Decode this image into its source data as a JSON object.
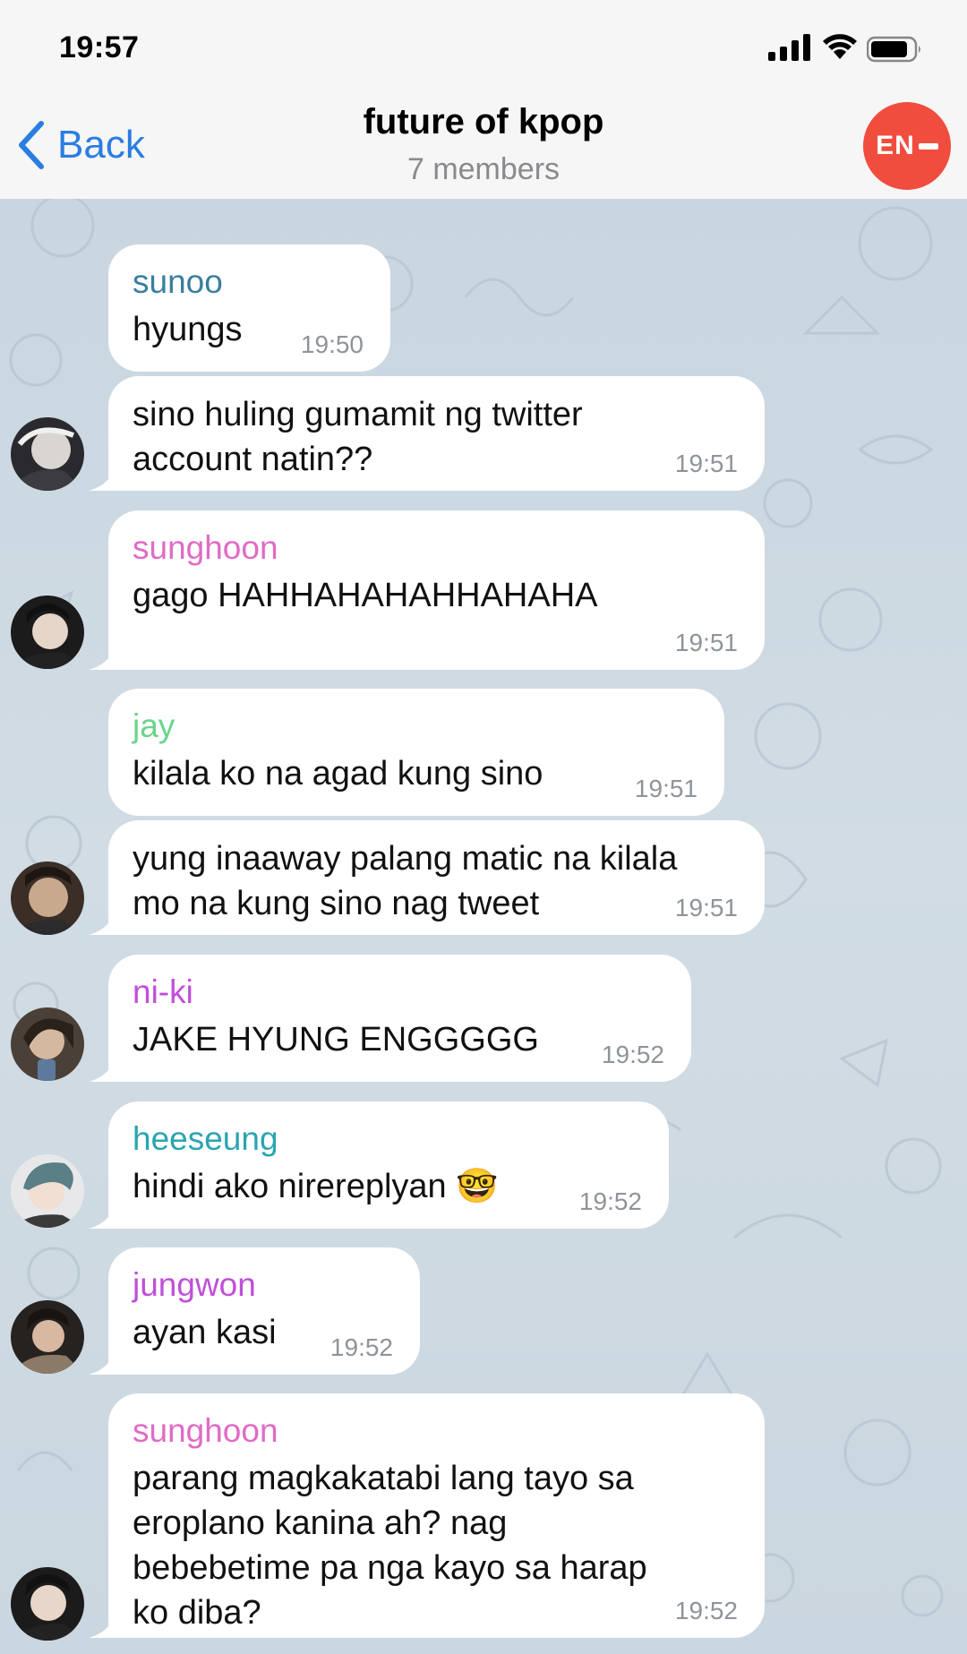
{
  "status_bar": {
    "time": "19:57"
  },
  "nav": {
    "back_label": "Back",
    "title": "future of kpop",
    "subtitle": "7 members",
    "group_avatar_text": "EN"
  },
  "colors": {
    "accent": "#2a7de1",
    "sunoo": "#3a7f9c",
    "sunghoon": "#e06bc5",
    "jay": "#6ad48a",
    "niki": "#c04fd8",
    "heeseung": "#2aa5b0",
    "jungwon": "#c04fd8"
  },
  "messages": [
    {
      "sender": "sunoo",
      "text": "hyungs",
      "time": "19:50"
    },
    {
      "sender": "",
      "text": "sino huling gumamit ng twitter\naccount natin??",
      "time": "19:51"
    },
    {
      "sender": "sunghoon",
      "text": "gago HAHHAHAHAHHAHAHA",
      "time": "19:51"
    },
    {
      "sender": "jay",
      "text": "kilala ko na agad kung sino",
      "time": "19:51"
    },
    {
      "sender": "",
      "text": "yung inaaway palang matic na kilala\nmo na kung sino nag tweet",
      "time": "19:51"
    },
    {
      "sender": "ni-ki",
      "text": "JAKE HYUNG ENGGGGG",
      "time": "19:52"
    },
    {
      "sender": "heeseung",
      "text": "hindi ako nirereplyan 🤓",
      "time": "19:52"
    },
    {
      "sender": "jungwon",
      "text": "ayan kasi",
      "time": "19:52"
    },
    {
      "sender": "sunghoon",
      "text": "parang magkakatabi lang tayo sa\neroplano kanina ah? nag\nbebebetime pa nga kayo sa harap\nko diba?",
      "time": "19:52"
    }
  ]
}
